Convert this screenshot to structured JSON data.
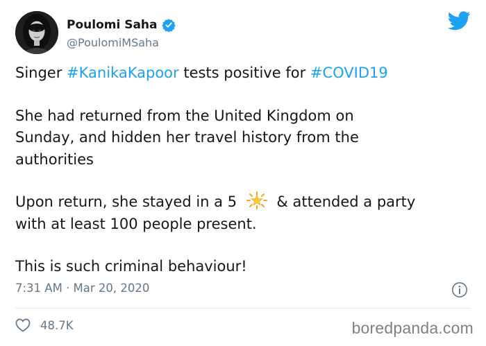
{
  "author": {
    "display_name": "Poulomi Saha",
    "handle": "@PoulomiMSaha",
    "verified": true
  },
  "tweet": {
    "p1": {
      "pre": "Singer ",
      "tag1": "#KanikaKapoor",
      "mid": " tests positive for ",
      "tag2": "#COVID19"
    },
    "p2": [
      "She had returned from the United Kingdom on",
      "Sunday, and hidden her travel history from the",
      "authorities"
    ],
    "p3": {
      "line1_pre": "Upon return, she stayed in a 5 ",
      "line1_icon": "star-emoji",
      "line1_post": " & attended a party",
      "line2": "with at least 100 people present."
    },
    "p4": "This is such criminal behaviour!"
  },
  "meta": {
    "timestamp": "7:31 AM · Mar 20, 2020",
    "like_count": "48.7K"
  },
  "watermark": "boredpanda.com",
  "icons": {
    "platform": "twitter-bird-icon",
    "verified": "verified-badge-icon",
    "info": "info-icon",
    "like": "heart-icon"
  },
  "colors": {
    "link": "#1da1f2",
    "text": "#14171a",
    "muted": "#657786",
    "divider": "#e1e8ed",
    "watermark": "#808080"
  }
}
